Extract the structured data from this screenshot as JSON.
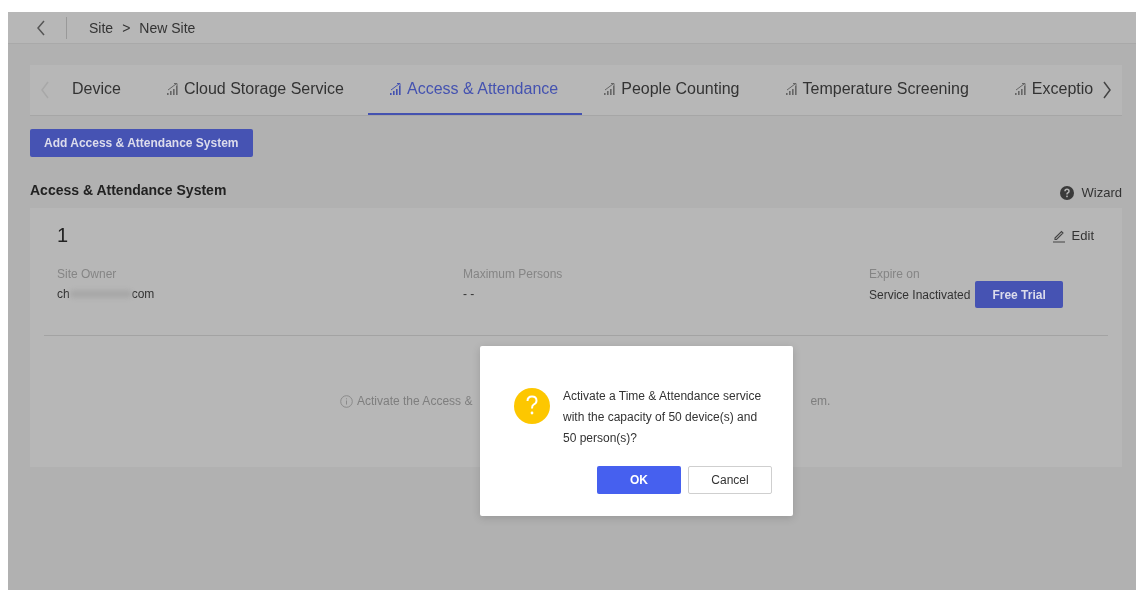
{
  "header": {
    "breadcrumb": [
      "Site",
      "New Site"
    ],
    "separator": ">"
  },
  "tabs": [
    {
      "label": "Device",
      "kind": "plain",
      "selected": false
    },
    {
      "label": "Cloud Storage Service",
      "kind": "service",
      "selected": false
    },
    {
      "label": "Access & Attendance",
      "kind": "service",
      "selected": true
    },
    {
      "label": "People Counting",
      "kind": "service",
      "selected": false
    },
    {
      "label": "Temperature Screening",
      "kind": "service",
      "selected": false
    },
    {
      "label": "Exceptio",
      "kind": "service",
      "selected": false
    }
  ],
  "add_button": "Add Access & Attendance System",
  "section": {
    "title": "Access & Attendance System",
    "wizard": "Wizard"
  },
  "card": {
    "number": "1",
    "edit": "Edit",
    "site_owner": {
      "label": "Site Owner",
      "value_start": "ch",
      "value_end": "com"
    },
    "max_persons": {
      "label": "Maximum Persons",
      "value": "- -"
    },
    "expire": {
      "label": "Expire on",
      "value": "Service Inactivated",
      "button": "Free Trial"
    },
    "hint_left": "Activate the Access &",
    "hint_right": "em."
  },
  "dialog": {
    "message": "Activate a Time & Attendance service with the capacity of 50 device(s) and 50 person(s)?",
    "ok": "OK",
    "cancel": "Cancel"
  }
}
